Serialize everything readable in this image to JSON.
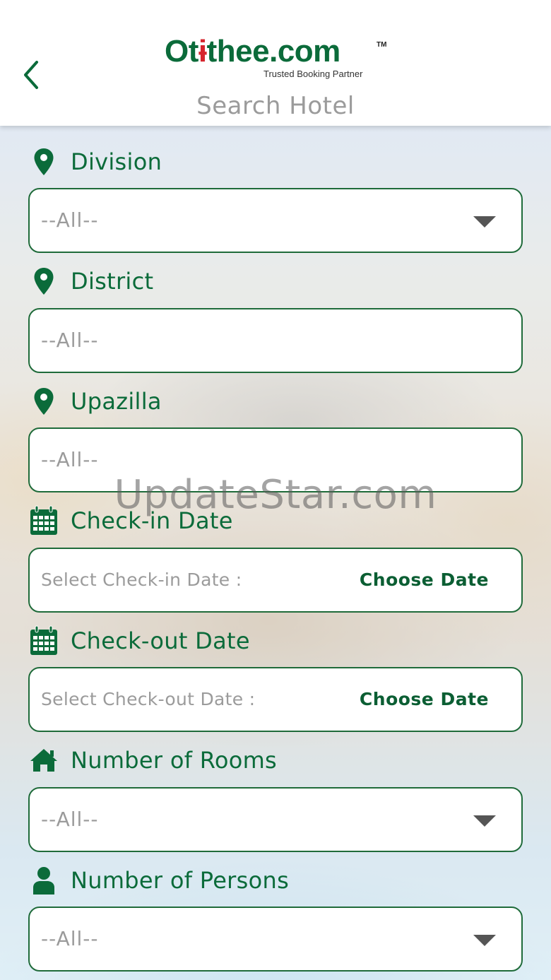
{
  "header": {
    "back_icon": "chevron-left-icon",
    "logo": {
      "part1": "Ot",
      "part2": "thee",
      "part3": ".com",
      "tm": "TM",
      "tagline": "Trusted Booking Partner"
    },
    "title": "Search Hotel"
  },
  "colors": {
    "brand_green": "#0b6b3a",
    "brand_red": "#d6252d",
    "border": "#1f6b3a",
    "muted": "#9b9b9b"
  },
  "form": {
    "division": {
      "icon": "location-pin-icon",
      "label": "Division",
      "value": "--All--"
    },
    "district": {
      "icon": "location-pin-icon",
      "label": "District",
      "value": "--All--"
    },
    "upazilla": {
      "icon": "location-pin-icon",
      "label": "Upazilla",
      "value": "--All--"
    },
    "checkin": {
      "icon": "calendar-icon",
      "label": "Check-in Date",
      "hint": "Select Check-in Date :",
      "action": "Choose Date"
    },
    "checkout": {
      "icon": "calendar-icon",
      "label": "Check-out Date",
      "hint": "Select Check-out Date :",
      "action": "Choose Date"
    },
    "rooms": {
      "icon": "home-icon",
      "label": "Number of Rooms",
      "value": "--All--"
    },
    "persons": {
      "icon": "person-icon",
      "label": "Number of Persons",
      "value": "--All--"
    }
  },
  "watermark": "UpdateStar.com"
}
